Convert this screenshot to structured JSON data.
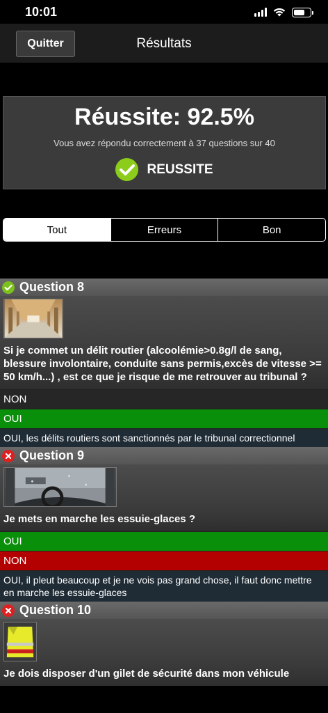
{
  "status_bar": {
    "time": "10:01"
  },
  "nav": {
    "quit_label": "Quitter",
    "title": "Résultats"
  },
  "result": {
    "score_text": "Réussite: 92.5%",
    "summary": "Vous avez répondu correctement à 37 questions sur 40",
    "status": "REUSSITE"
  },
  "filters": {
    "all": "Tout",
    "errors": "Erreurs",
    "good": "Bon"
  },
  "questions": [
    {
      "title": "Question 8",
      "text": "Si je commet un délit routier (alcoolémie>0.8g/l de sang, blessure involontaire, conduite sans permis,excès de vitesse >= 50 km/h...) , est ce que je risque de me retrouver au tribunal ?",
      "answers": [
        "NON",
        "OUI"
      ],
      "explanation": "OUI, les délits routiers sont sanctionnés par le tribunal correctionnel"
    },
    {
      "title": "Question 9",
      "text": "Je mets en marche les essuie-glaces ?",
      "answers": [
        "OUI",
        "NON"
      ],
      "explanation": "OUI, il pleut beaucoup et je ne vois pas grand chose, il faut donc mettre en marche les essuie-glaces"
    },
    {
      "title": "Question 10",
      "text": "Je dois disposer d'un gilet de sécurité dans mon véhicule"
    }
  ],
  "colors": {
    "correct": "#0a8f0a",
    "wrong": "#b30000",
    "success_icon": "#8ccc1a"
  }
}
